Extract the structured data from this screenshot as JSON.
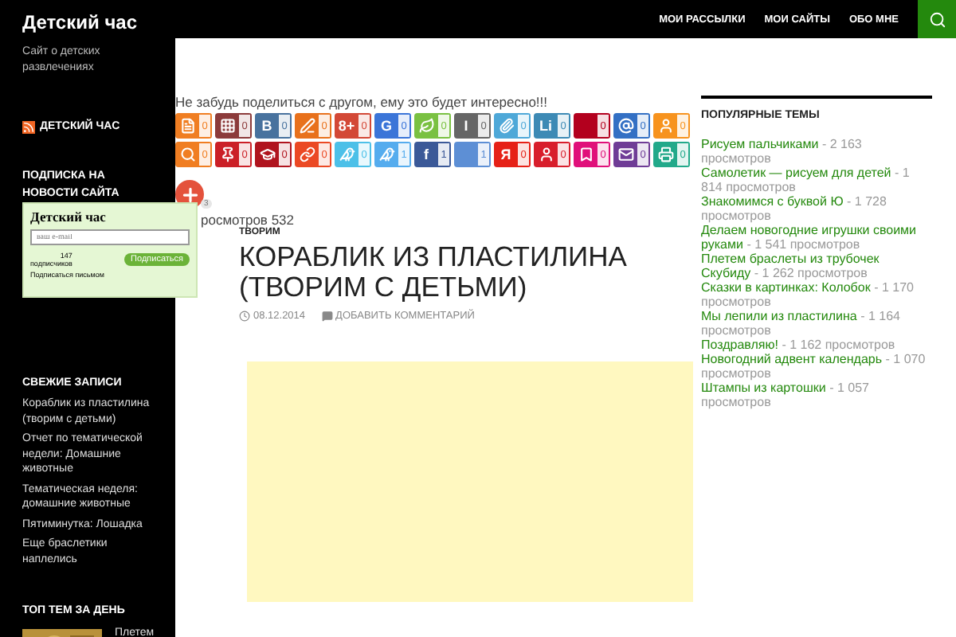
{
  "site": {
    "title": "Детский час",
    "tagline": "Сайт о детских развлечениях"
  },
  "nav": {
    "items": [
      "МОИ РАССЫЛКИ",
      "МОИ САЙТЫ",
      "ОБО МНЕ"
    ]
  },
  "sidebar": {
    "rss_title": "ДЕТСКИЙ ЧАС",
    "subscribe_heading": "ПОДПИСКА НА НОВОСТИ САЙТА",
    "recent_heading": "СВЕЖИЕ ЗАПИСИ",
    "recent_posts": [
      "Кораблик из пластилина (творим с детьми)",
      "Отчет по тематической недели: Домашние животные",
      "Тематическая неделя: домашние животные",
      "Пятиминутка: Лошадка",
      "Еще браслетики наплелись"
    ],
    "top_heading": "ТОП ТЕМ ЗА ДЕНЬ",
    "top_item": {
      "kind": "picture",
      "title": "Плетем"
    }
  },
  "subscribe_widget": {
    "title": "Детский час",
    "placeholder": "ваш e-mail",
    "count": "147",
    "count_label": "подписчиков",
    "button": "Подписаться",
    "letter_link": "Подписаться письмом"
  },
  "share": {
    "prompt": "Не забудь поделиться с другом, ему это будет интересно!!!",
    "buttons": [
      {
        "kind": "doc",
        "color": "#f07e22",
        "count": "0"
      },
      {
        "kind": "grid",
        "color": "#8c3b3b",
        "count": "0"
      },
      {
        "kind": "glyph",
        "glyph": "B",
        "color": "#48729e",
        "count": "0"
      },
      {
        "kind": "pen",
        "color": "#e8711c",
        "count": "0"
      },
      {
        "kind": "glyph",
        "glyph": "8+",
        "color": "#d34836",
        "count": "0"
      },
      {
        "kind": "glyph",
        "glyph": "G",
        "color": "#3b75d8",
        "count": "0"
      },
      {
        "kind": "leaf",
        "color": "#7ac142",
        "count": "0"
      },
      {
        "kind": "glyph",
        "glyph": "I",
        "color": "#666666",
        "count": "0"
      },
      {
        "kind": "clip",
        "color": "#4ea8d8",
        "count": "0"
      },
      {
        "kind": "glyph",
        "glyph": "Li",
        "color": "#3d8ab5",
        "count": "0"
      },
      {
        "kind": "blank",
        "color": "#b3001e",
        "count": "0"
      },
      {
        "kind": "at",
        "color": "#3370c4",
        "count": "0"
      },
      {
        "kind": "person",
        "color": "#f7931e",
        "count": "0"
      },
      {
        "kind": "search",
        "color": "#f07e22",
        "count": "0"
      },
      {
        "kind": "pin",
        "color": "#cb2027",
        "count": "0"
      },
      {
        "kind": "hat",
        "color": "#b0141e",
        "count": "0"
      },
      {
        "kind": "link",
        "color": "#eb4924",
        "count": "0"
      },
      {
        "kind": "bird",
        "color": "#4cc0e8",
        "count": "0"
      },
      {
        "kind": "bird",
        "color": "#55acee",
        "count": "1"
      },
      {
        "kind": "glyph",
        "glyph": "f",
        "color": "#3b5998",
        "count": "1"
      },
      {
        "kind": "blank",
        "color": "#5d8fd5",
        "count": "1"
      },
      {
        "kind": "glyph",
        "glyph": "Я",
        "color": "#e62117",
        "count": "0"
      },
      {
        "kind": "person",
        "color": "#d81e2c",
        "count": "0"
      },
      {
        "kind": "bookmark",
        "color": "#e0107a",
        "count": "0"
      },
      {
        "kind": "mail",
        "color": "#6f3c96",
        "count": "0"
      },
      {
        "kind": "print",
        "color": "#22a98a",
        "count": "0"
      }
    ],
    "more_count": "3"
  },
  "post": {
    "views": "росмотров 532",
    "category": "ТВОРИМ",
    "title": "КОРАБЛИК ИЗ ПЛАСТИЛИНА (ТВОРИМ С ДЕТЬМИ)",
    "date": "08.12.2014",
    "comment_link": "ДОБАВИТЬ КОММЕНТАРИЙ"
  },
  "popular": {
    "heading": "ПОПУЛЯРНЫЕ ТЕМЫ",
    "items": [
      {
        "title": "Рисуем пальчиками",
        "views": "- 2 163 просмотров"
      },
      {
        "title": "Самолетик — рисуем для детей",
        "views": "- 1 814 просмотров"
      },
      {
        "title": "Знакомимся с буквой Ю",
        "views": "- 1 728 просмотров"
      },
      {
        "title": "Делаем новогодние игрушки своими руками",
        "views": "- 1 541 просмотров"
      },
      {
        "title": "Плетем браслеты из трубочек Скубиду",
        "views": "- 1 262 просмотров"
      },
      {
        "title": "Сказки в картинках: Колобок",
        "views": "- 1 170 просмотров"
      },
      {
        "title": "Мы лепили из пластилина",
        "views": "- 1 164 просмотров"
      },
      {
        "title": "Поздравляю!",
        "views": "- 1 162 просмотров"
      },
      {
        "title": "Новогодний адвент календарь",
        "views": "- 1 070 просмотров"
      },
      {
        "title": "Штампы из картошки",
        "views": "- 1 057 просмотров"
      }
    ]
  }
}
